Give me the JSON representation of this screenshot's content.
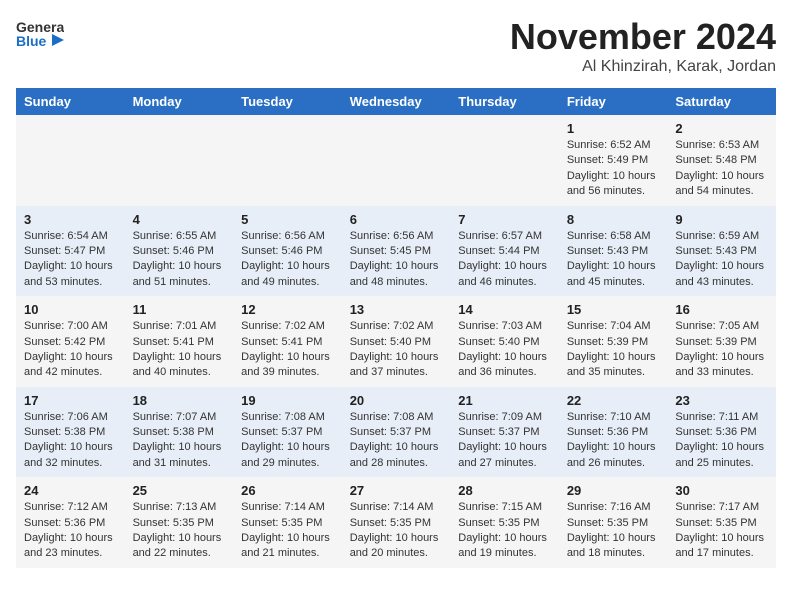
{
  "header": {
    "logo_line1": "General",
    "logo_line2": "Blue",
    "title": "November 2024",
    "subtitle": "Al Khinzirah, Karak, Jordan"
  },
  "days_of_week": [
    "Sunday",
    "Monday",
    "Tuesday",
    "Wednesday",
    "Thursday",
    "Friday",
    "Saturday"
  ],
  "weeks": [
    [
      {
        "day": "",
        "info": ""
      },
      {
        "day": "",
        "info": ""
      },
      {
        "day": "",
        "info": ""
      },
      {
        "day": "",
        "info": ""
      },
      {
        "day": "",
        "info": ""
      },
      {
        "day": "1",
        "info": "Sunrise: 6:52 AM\nSunset: 5:49 PM\nDaylight: 10 hours\nand 56 minutes."
      },
      {
        "day": "2",
        "info": "Sunrise: 6:53 AM\nSunset: 5:48 PM\nDaylight: 10 hours\nand 54 minutes."
      }
    ],
    [
      {
        "day": "3",
        "info": "Sunrise: 6:54 AM\nSunset: 5:47 PM\nDaylight: 10 hours\nand 53 minutes."
      },
      {
        "day": "4",
        "info": "Sunrise: 6:55 AM\nSunset: 5:46 PM\nDaylight: 10 hours\nand 51 minutes."
      },
      {
        "day": "5",
        "info": "Sunrise: 6:56 AM\nSunset: 5:46 PM\nDaylight: 10 hours\nand 49 minutes."
      },
      {
        "day": "6",
        "info": "Sunrise: 6:56 AM\nSunset: 5:45 PM\nDaylight: 10 hours\nand 48 minutes."
      },
      {
        "day": "7",
        "info": "Sunrise: 6:57 AM\nSunset: 5:44 PM\nDaylight: 10 hours\nand 46 minutes."
      },
      {
        "day": "8",
        "info": "Sunrise: 6:58 AM\nSunset: 5:43 PM\nDaylight: 10 hours\nand 45 minutes."
      },
      {
        "day": "9",
        "info": "Sunrise: 6:59 AM\nSunset: 5:43 PM\nDaylight: 10 hours\nand 43 minutes."
      }
    ],
    [
      {
        "day": "10",
        "info": "Sunrise: 7:00 AM\nSunset: 5:42 PM\nDaylight: 10 hours\nand 42 minutes."
      },
      {
        "day": "11",
        "info": "Sunrise: 7:01 AM\nSunset: 5:41 PM\nDaylight: 10 hours\nand 40 minutes."
      },
      {
        "day": "12",
        "info": "Sunrise: 7:02 AM\nSunset: 5:41 PM\nDaylight: 10 hours\nand 39 minutes."
      },
      {
        "day": "13",
        "info": "Sunrise: 7:02 AM\nSunset: 5:40 PM\nDaylight: 10 hours\nand 37 minutes."
      },
      {
        "day": "14",
        "info": "Sunrise: 7:03 AM\nSunset: 5:40 PM\nDaylight: 10 hours\nand 36 minutes."
      },
      {
        "day": "15",
        "info": "Sunrise: 7:04 AM\nSunset: 5:39 PM\nDaylight: 10 hours\nand 35 minutes."
      },
      {
        "day": "16",
        "info": "Sunrise: 7:05 AM\nSunset: 5:39 PM\nDaylight: 10 hours\nand 33 minutes."
      }
    ],
    [
      {
        "day": "17",
        "info": "Sunrise: 7:06 AM\nSunset: 5:38 PM\nDaylight: 10 hours\nand 32 minutes."
      },
      {
        "day": "18",
        "info": "Sunrise: 7:07 AM\nSunset: 5:38 PM\nDaylight: 10 hours\nand 31 minutes."
      },
      {
        "day": "19",
        "info": "Sunrise: 7:08 AM\nSunset: 5:37 PM\nDaylight: 10 hours\nand 29 minutes."
      },
      {
        "day": "20",
        "info": "Sunrise: 7:08 AM\nSunset: 5:37 PM\nDaylight: 10 hours\nand 28 minutes."
      },
      {
        "day": "21",
        "info": "Sunrise: 7:09 AM\nSunset: 5:37 PM\nDaylight: 10 hours\nand 27 minutes."
      },
      {
        "day": "22",
        "info": "Sunrise: 7:10 AM\nSunset: 5:36 PM\nDaylight: 10 hours\nand 26 minutes."
      },
      {
        "day": "23",
        "info": "Sunrise: 7:11 AM\nSunset: 5:36 PM\nDaylight: 10 hours\nand 25 minutes."
      }
    ],
    [
      {
        "day": "24",
        "info": "Sunrise: 7:12 AM\nSunset: 5:36 PM\nDaylight: 10 hours\nand 23 minutes."
      },
      {
        "day": "25",
        "info": "Sunrise: 7:13 AM\nSunset: 5:35 PM\nDaylight: 10 hours\nand 22 minutes."
      },
      {
        "day": "26",
        "info": "Sunrise: 7:14 AM\nSunset: 5:35 PM\nDaylight: 10 hours\nand 21 minutes."
      },
      {
        "day": "27",
        "info": "Sunrise: 7:14 AM\nSunset: 5:35 PM\nDaylight: 10 hours\nand 20 minutes."
      },
      {
        "day": "28",
        "info": "Sunrise: 7:15 AM\nSunset: 5:35 PM\nDaylight: 10 hours\nand 19 minutes."
      },
      {
        "day": "29",
        "info": "Sunrise: 7:16 AM\nSunset: 5:35 PM\nDaylight: 10 hours\nand 18 minutes."
      },
      {
        "day": "30",
        "info": "Sunrise: 7:17 AM\nSunset: 5:35 PM\nDaylight: 10 hours\nand 17 minutes."
      }
    ]
  ]
}
